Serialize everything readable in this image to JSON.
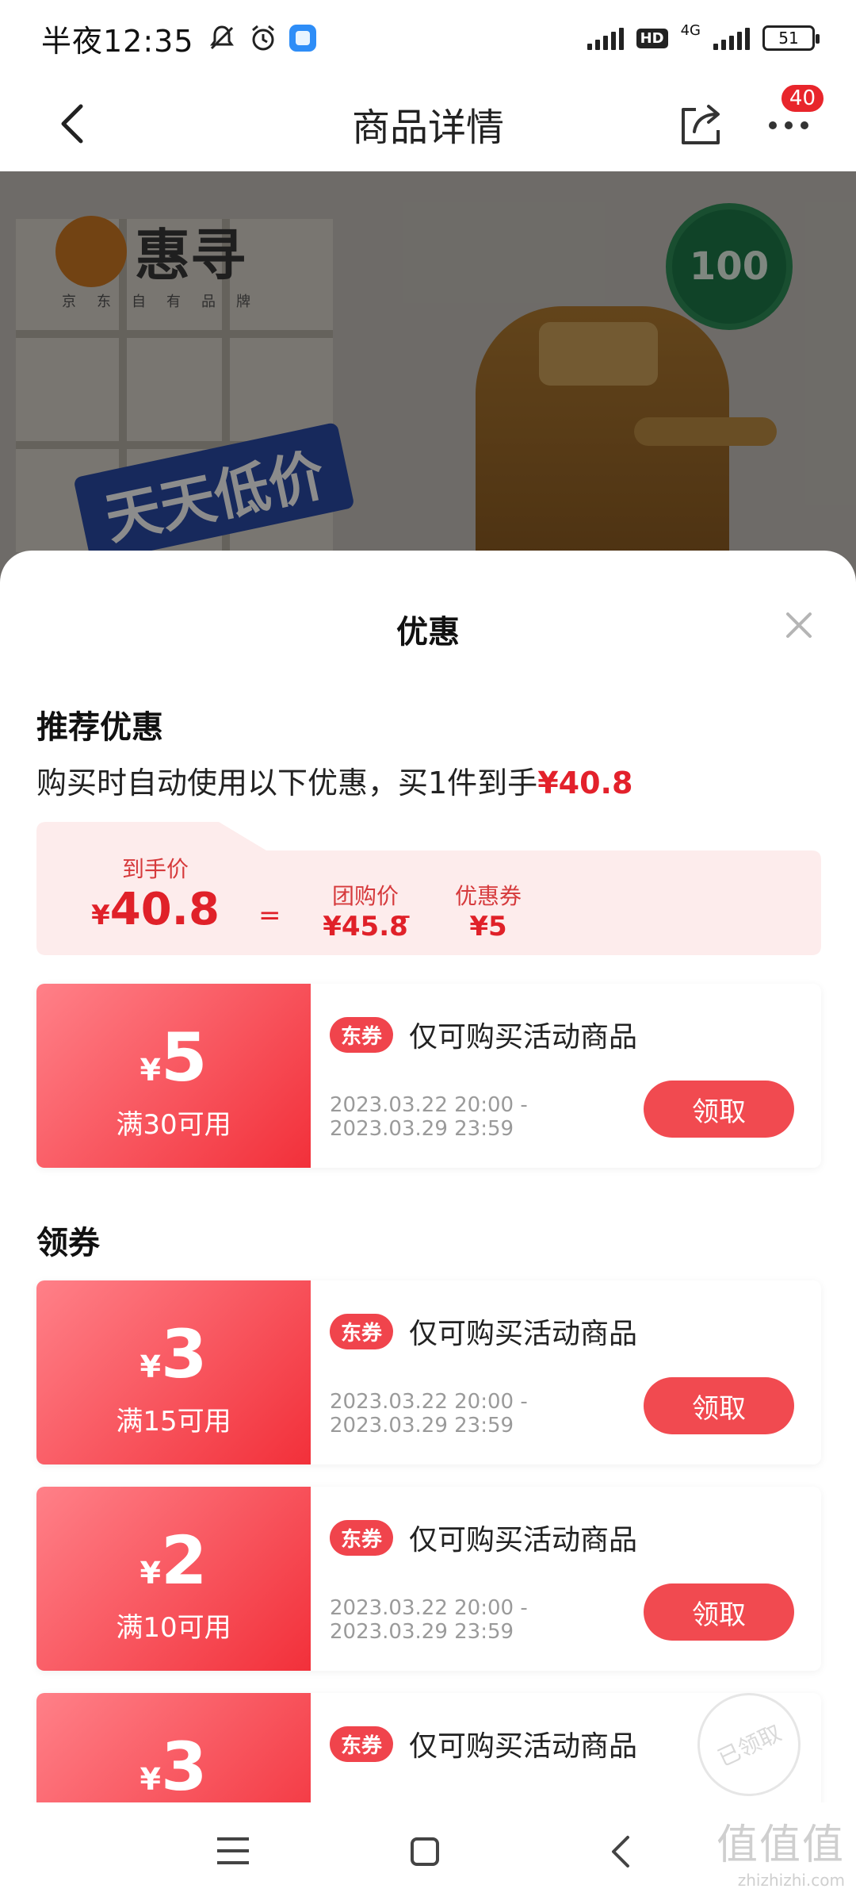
{
  "status_bar": {
    "time": "半夜12:35",
    "network": "4G",
    "hd": "HD",
    "battery": "51"
  },
  "header": {
    "title": "商品详情",
    "badge_count": "40"
  },
  "hero": {
    "brand_name": "惠寻",
    "brand_sub": "京东自有品牌",
    "seal_text": "100",
    "promo_text": "天天低价"
  },
  "sheet": {
    "title": "优惠",
    "recommend": {
      "title": "推荐优惠",
      "desc_prefix": "购买时自动使用以下优惠，买1件到手",
      "desc_price": "¥40.8",
      "final_label": "到手价",
      "final_cur": "¥",
      "final_value": "40.8",
      "equals": "=",
      "group_label": "团购价",
      "group_value": "¥45.8",
      "minus": "-",
      "coupon_label": "优惠券",
      "coupon_value": "¥5"
    },
    "claim_title": "领券",
    "coupons": [
      {
        "currency": "¥",
        "amount": "5",
        "condition": "满30可用",
        "tag": "东券",
        "desc": "仅可购买活动商品",
        "date": "2023.03.22 20:00 - 2023.03.29 23:59",
        "button": "领取"
      },
      {
        "currency": "¥",
        "amount": "3",
        "condition": "满15可用",
        "tag": "东券",
        "desc": "仅可购买活动商品",
        "date": "2023.03.22 20:00 - 2023.03.29 23:59",
        "button": "领取"
      },
      {
        "currency": "¥",
        "amount": "2",
        "condition": "满10可用",
        "tag": "东券",
        "desc": "仅可购买活动商品",
        "date": "2023.03.22 20:00 - 2023.03.29 23:59",
        "button": "领取"
      },
      {
        "currency": "¥",
        "amount": "3",
        "tag": "东券",
        "desc": "仅可购买活动商品"
      }
    ],
    "stamp_text": "已领取"
  },
  "watermark": {
    "chars": "值值值",
    "site": "zhizhizhi.com"
  }
}
